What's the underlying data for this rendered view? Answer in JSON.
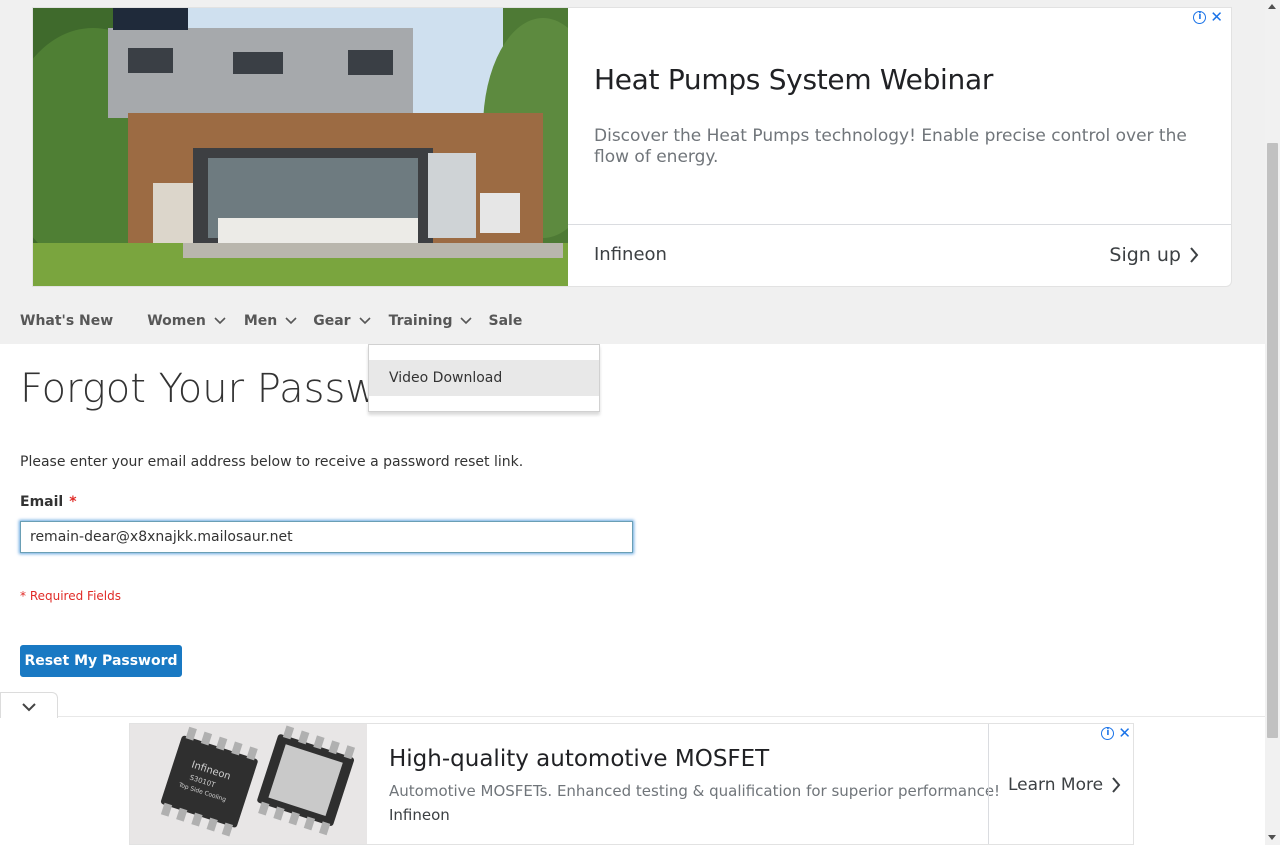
{
  "top_ad": {
    "headline": "Heat Pumps System Webinar",
    "description": "Discover the Heat Pumps technology! Enable precise control over the flow of energy.",
    "advertiser": "Infineon",
    "cta": "Sign up",
    "info_glyph": "i",
    "close_glyph": "✕"
  },
  "nav": {
    "items": [
      {
        "label": "What's New"
      },
      {
        "label": "Women"
      },
      {
        "label": "Men"
      },
      {
        "label": "Gear"
      },
      {
        "label": "Training"
      },
      {
        "label": "Sale"
      }
    ],
    "dropdown": {
      "items": [
        {
          "label": "Video Download"
        }
      ]
    }
  },
  "form": {
    "title": "Forgot Your Password?",
    "intro": "Please enter your email address below to receive a password reset link.",
    "email_label": "Email",
    "required_mark": "*",
    "email_value": "remain-dear@x8xnajkk.mailosaur.net",
    "required_note": "* Required Fields",
    "submit_label": "Reset My Password"
  },
  "bottom_ad": {
    "headline": "High-quality automotive MOSFET",
    "description": "Automotive MOSFETs. Enhanced testing & qualification for superior performance!",
    "advertiser": "Infineon",
    "cta": "Learn More",
    "chip_label_1": "Infineon",
    "chip_label_2": "S3010T",
    "chip_label_3": "Top Side Cooling",
    "info_glyph": "i",
    "close_glyph": "✕"
  },
  "colors": {
    "primary_button": "#1979c3",
    "required": "#e02b27",
    "nav_bg": "#f0f0f0",
    "ad_icon": "#1a73e8"
  }
}
